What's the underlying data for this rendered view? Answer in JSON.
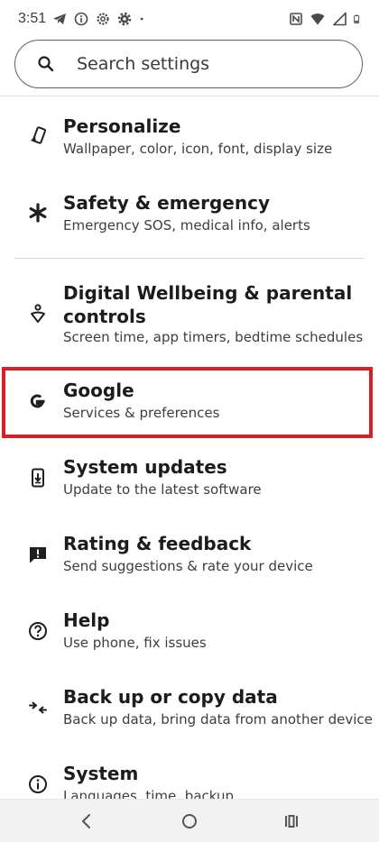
{
  "status_bar": {
    "time": "3:51",
    "left_icons": [
      "telegram-icon",
      "info-icon",
      "settings-gear-icon",
      "settings-icon",
      "dot-icon"
    ],
    "right_icons": [
      "nfc-icon",
      "wifi-icon",
      "signal-icon",
      "battery-icon"
    ]
  },
  "search": {
    "placeholder": "Search settings"
  },
  "items": [
    {
      "title": "Personalize",
      "subtitle": "Wallpaper, color, icon, font, display size",
      "icon": "personalize-icon"
    },
    {
      "title": "Safety & emergency",
      "subtitle": "Emergency SOS, medical info, alerts",
      "icon": "asterisk-icon"
    },
    {
      "title": "Digital Wellbeing & parental controls",
      "subtitle": "Screen time, app timers, bedtime schedules",
      "icon": "wellbeing-icon"
    },
    {
      "title": "Google",
      "subtitle": "Services & preferences",
      "icon": "google-icon"
    },
    {
      "title": "System updates",
      "subtitle": "Update to the latest software",
      "icon": "system-update-icon"
    },
    {
      "title": "Rating & feedback",
      "subtitle": "Send suggestions & rate your device",
      "icon": "feedback-icon"
    },
    {
      "title": "Help",
      "subtitle": "Use phone, fix issues",
      "icon": "help-icon"
    },
    {
      "title": "Back up or copy data",
      "subtitle": "Back up data, bring data from another device",
      "icon": "backup-icon"
    },
    {
      "title": "System",
      "subtitle": "Languages, time, backup",
      "icon": "info-icon"
    }
  ],
  "highlight_color": "#d81f26",
  "nav": {
    "icons": [
      "back-icon",
      "home-icon",
      "recents-icon"
    ]
  }
}
